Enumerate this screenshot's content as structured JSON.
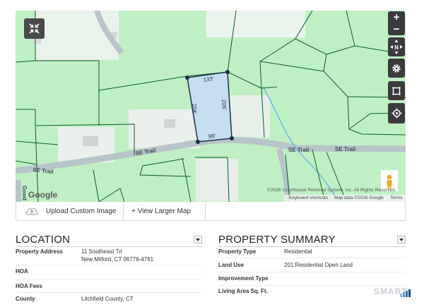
{
  "map": {
    "road_labels": [
      "SE Trail",
      "SE Trail",
      "SE Trail",
      "Good"
    ],
    "dimensions": [
      "133'",
      "206'",
      "204'",
      "99'"
    ],
    "attribution": "©2026 Courthouse Retrieval System, Inc. All Rights Reserved.",
    "footer_links": [
      "Keyboard shortcuts",
      "Map data ©2026 Google",
      "Terms"
    ],
    "google_logo": "Google",
    "zoom_in": "+",
    "zoom_out": "−",
    "north_label": "N",
    "colors": {
      "map_bg": "#bff0c4",
      "parcel_line": "#0a5c2a",
      "parcel_fill": "#c5dff0",
      "road": "#b7c4c9",
      "stream": "#6eb8e6"
    }
  },
  "toolbar": {
    "upload_label": "Upload Custom Image",
    "larger_map_label": "+ View Larger Map"
  },
  "location": {
    "title": "LOCATION",
    "rows": [
      {
        "label": "Property Address",
        "value": "11 Southeast Trl",
        "value2": "New Milford, CT 06776-4761"
      },
      {
        "label": "HOA",
        "value": ""
      },
      {
        "label": "HOA Fees",
        "value": ""
      },
      {
        "label": "County",
        "value": "Litchfield County, CT"
      }
    ]
  },
  "summary": {
    "title": "PROPERTY SUMMARY",
    "rows": [
      {
        "label": "Property Type",
        "value": "Residential"
      },
      {
        "label": "Land Use",
        "value": "201:Residential Open Land"
      },
      {
        "label": "Improvement Type",
        "value": ""
      },
      {
        "label": "Living Area Sq. Ft.",
        "value": ""
      }
    ]
  },
  "watermark": "SMART"
}
